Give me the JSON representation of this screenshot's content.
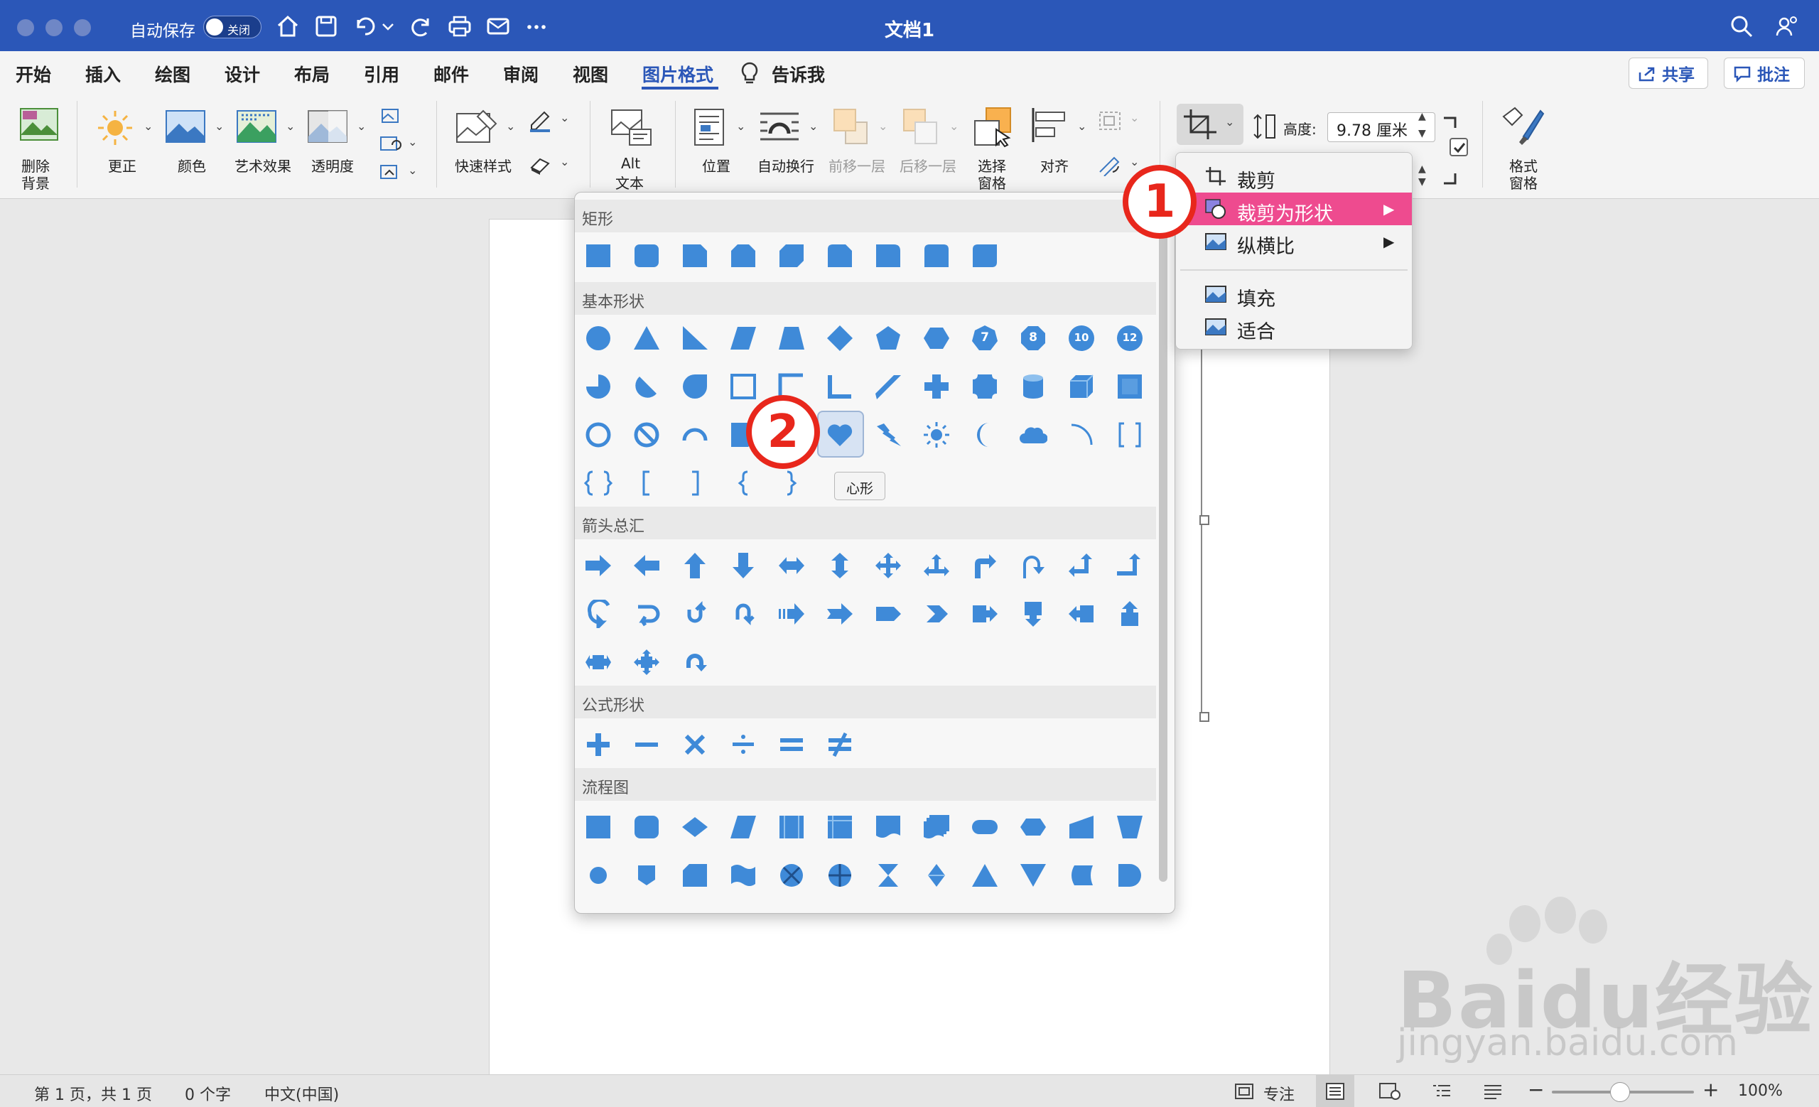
{
  "window": {
    "title": "文档1",
    "autosave_label": "自动保存",
    "autosave_state": "关闭"
  },
  "tabs": [
    "开始",
    "插入",
    "绘图",
    "设计",
    "布局",
    "引用",
    "邮件",
    "审阅",
    "视图",
    "图片格式",
    "告诉我"
  ],
  "active_tab": "图片格式",
  "top_buttons": {
    "share": "共享",
    "comments": "批注"
  },
  "ribbon": {
    "remove_bg": [
      "删除",
      "背景"
    ],
    "corrections": "更正",
    "color": "颜色",
    "artistic": "艺术效果",
    "transparency": "透明度",
    "quick_styles": "快速样式",
    "alt_text": [
      "Alt",
      "文本"
    ],
    "position": "位置",
    "wrap_text": "自动换行",
    "bring_forward": "前移一层",
    "send_backward": "后移一层",
    "selection_pane": [
      "选择",
      "窗格"
    ],
    "align": "对齐",
    "height_label": "高度:",
    "height_value": "9.78 厘米",
    "format_pane": [
      "格式",
      "窗格"
    ]
  },
  "crop_menu": {
    "items": [
      {
        "label": "裁剪",
        "submenu": false
      },
      {
        "label": "裁剪为形状",
        "submenu": true,
        "highlighted": true
      },
      {
        "label": "纵横比",
        "submenu": true
      },
      {
        "label": "填充",
        "submenu": false
      },
      {
        "label": "适合",
        "submenu": false
      }
    ],
    "highlight_color": "#ee4b8f"
  },
  "gallery": {
    "sections": [
      "矩形",
      "基本形状",
      "箭头总汇",
      "公式形状",
      "流程图"
    ],
    "badge_numbers": [
      "7",
      "8",
      "10",
      "12"
    ],
    "shape_color": "#3f8ad8",
    "hovered_shape": "心形"
  },
  "badges": [
    "1",
    "2"
  ],
  "status": {
    "page": "第 1 页，共 1 页",
    "words": "0 个字",
    "language": "中文(中国)",
    "focus": "专注",
    "zoom": "100%"
  },
  "watermark": {
    "text": "Baidu经验",
    "sub": "jingyan.baidu.com"
  },
  "colors": {
    "titlebar": "#2b57b8",
    "accent": "#2b57b8",
    "badge_red": "#e8271c"
  }
}
